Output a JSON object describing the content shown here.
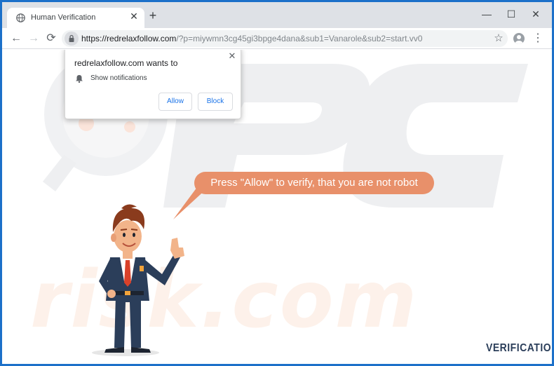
{
  "tab": {
    "title": "Human Verification",
    "close": "✕",
    "new_tab": "+"
  },
  "window_controls": {
    "minimize": "—",
    "maximize": "☐",
    "close": "✕"
  },
  "toolbar": {
    "back": "←",
    "forward": "→",
    "reload": "⟳",
    "url_host": "https://redrelaxfollow.com",
    "url_path": "/?p=miywmn3cg45gi3bpge4dana&sub1=Vanarole&sub2=start.vv0",
    "bookmark": "☆",
    "menu": "⋮"
  },
  "permission_popup": {
    "title": "redrelaxfollow.com wants to",
    "close": "✕",
    "permission": "Show notifications",
    "allow_label": "Allow",
    "block_label": "Block"
  },
  "page": {
    "speech_bubble": "Press \"Allow\" to verify, that you are not robot",
    "brand": "VERIFICATION"
  },
  "colors": {
    "frame": "#1c70c9",
    "bubble": "#e8906a",
    "link_blue": "#1a73e8",
    "suit": "#2b3e5a",
    "tie": "#d9412a"
  },
  "icons": {
    "favicon": "globe-icon",
    "lock": "lock-icon",
    "bell": "bell-icon",
    "avatar": "user-avatar-icon"
  }
}
